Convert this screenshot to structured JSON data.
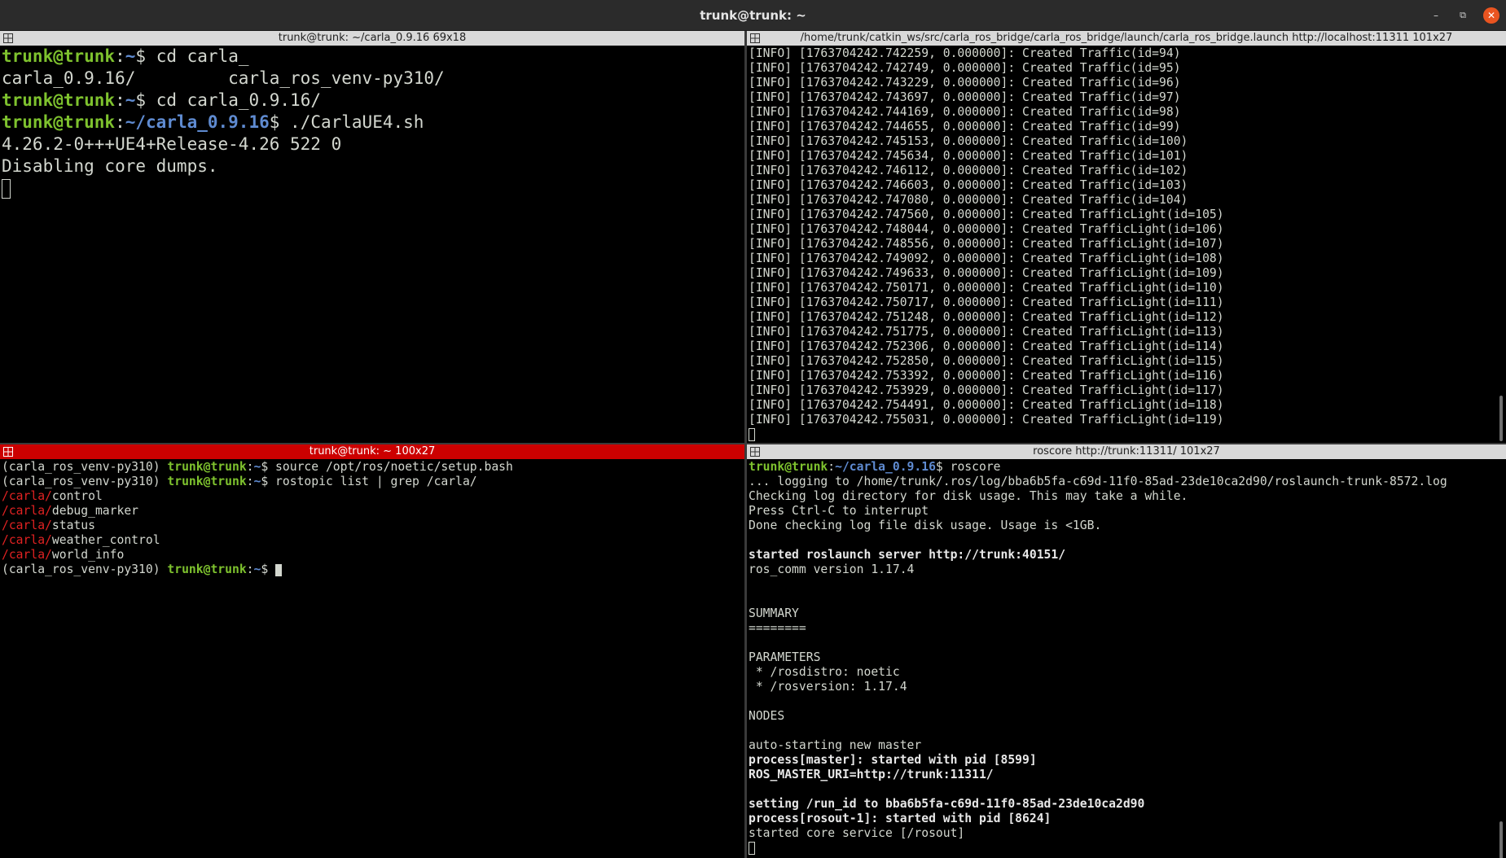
{
  "window": {
    "title": "trunk@trunk: ~",
    "controls": {
      "minimize": "–",
      "maximize": "⧉",
      "close": "✕"
    }
  },
  "colors": {
    "prompt_user": "#7ec22e",
    "prompt_path": "#5f8bd1",
    "grep_match": "#e02222",
    "active_pane_bar": "#cc0000",
    "inactive_pane_bar": "#d9d9d9"
  },
  "panes": {
    "top_left": {
      "title": "trunk@trunk: ~/carla_0.9.16 69x18",
      "lines": {
        "l1": {
          "user": "trunk@trunk",
          "sep": ":",
          "path": "~",
          "dollar": "$ ",
          "cmd": "cd carla_"
        },
        "l2": {
          "text": "carla_0.9.16/         carla_ros_venv-py310/"
        },
        "l3": {
          "user": "trunk@trunk",
          "sep": ":",
          "path": "~",
          "dollar": "$ ",
          "cmd": "cd carla_0.9.16/"
        },
        "l4": {
          "user": "trunk@trunk",
          "sep": ":",
          "path": "~/carla_0.9.16",
          "dollar": "$ ",
          "cmd": "./CarlaUE4.sh"
        },
        "l5": {
          "text": "4.26.2-0+++UE4+Release-4.26 522 0"
        },
        "l6": {
          "text": "Disabling core dumps."
        }
      }
    },
    "top_right": {
      "title": "/home/trunk/catkin_ws/src/carla_ros_bridge/carla_ros_bridge/launch/carla_ros_bridge.launch http://localhost:11311 101x27",
      "log": [
        "[INFO] [1763704242.742259, 0.000000]: Created Traffic(id=94)",
        "[INFO] [1763704242.742749, 0.000000]: Created Traffic(id=95)",
        "[INFO] [1763704242.743229, 0.000000]: Created Traffic(id=96)",
        "[INFO] [1763704242.743697, 0.000000]: Created Traffic(id=97)",
        "[INFO] [1763704242.744169, 0.000000]: Created Traffic(id=98)",
        "[INFO] [1763704242.744655, 0.000000]: Created Traffic(id=99)",
        "[INFO] [1763704242.745153, 0.000000]: Created Traffic(id=100)",
        "[INFO] [1763704242.745634, 0.000000]: Created Traffic(id=101)",
        "[INFO] [1763704242.746112, 0.000000]: Created Traffic(id=102)",
        "[INFO] [1763704242.746603, 0.000000]: Created Traffic(id=103)",
        "[INFO] [1763704242.747080, 0.000000]: Created Traffic(id=104)",
        "[INFO] [1763704242.747560, 0.000000]: Created TrafficLight(id=105)",
        "[INFO] [1763704242.748044, 0.000000]: Created TrafficLight(id=106)",
        "[INFO] [1763704242.748556, 0.000000]: Created TrafficLight(id=107)",
        "[INFO] [1763704242.749092, 0.000000]: Created TrafficLight(id=108)",
        "[INFO] [1763704242.749633, 0.000000]: Created TrafficLight(id=109)",
        "[INFO] [1763704242.750171, 0.000000]: Created TrafficLight(id=110)",
        "[INFO] [1763704242.750717, 0.000000]: Created TrafficLight(id=111)",
        "[INFO] [1763704242.751248, 0.000000]: Created TrafficLight(id=112)",
        "[INFO] [1763704242.751775, 0.000000]: Created TrafficLight(id=113)",
        "[INFO] [1763704242.752306, 0.000000]: Created TrafficLight(id=114)",
        "[INFO] [1763704242.752850, 0.000000]: Created TrafficLight(id=115)",
        "[INFO] [1763704242.753392, 0.000000]: Created TrafficLight(id=116)",
        "[INFO] [1763704242.753929, 0.000000]: Created TrafficLight(id=117)",
        "[INFO] [1763704242.754491, 0.000000]: Created TrafficLight(id=118)",
        "[INFO] [1763704242.755031, 0.000000]: Created TrafficLight(id=119)"
      ]
    },
    "bottom_left": {
      "title": "trunk@trunk: ~ 100x27",
      "venv": "(carla_ros_venv-py310) ",
      "user": "trunk@trunk",
      "sep": ":",
      "path": "~",
      "dollar": "$ ",
      "cmd1": "source /opt/ros/noetic/setup.bash",
      "cmd2": "rostopic list | grep /carla/",
      "match": "/carla/",
      "topics": [
        "control",
        "debug_marker",
        "status",
        "weather_control",
        "world_info"
      ]
    },
    "bottom_right": {
      "title": "roscore http://trunk:11311/ 101x27",
      "prompt": {
        "user": "trunk@trunk",
        "sep": ":",
        "path": "~/carla_0.9.16",
        "dollar": "$ ",
        "cmd": "roscore"
      },
      "lines": {
        "logging": "... logging to /home/trunk/.ros/log/bba6b5fa-c69d-11f0-85ad-23de10ca2d90/roslaunch-trunk-8572.log",
        "checking": "Checking log directory for disk usage. This may take a while.",
        "press": "Press Ctrl-C to interrupt",
        "done": "Done checking log file disk usage. Usage is <1GB.",
        "started_server": "started roslaunch server http://trunk:40151/",
        "ros_comm": "ros_comm version 1.17.4",
        "summary": "SUMMARY",
        "summary_rule": "========",
        "parameters": "PARAMETERS",
        "param1": " * /rosdistro: noetic",
        "param2": " * /rosversion: 1.17.4",
        "nodes": "NODES",
        "auto_start": "auto-starting new master",
        "process_master": "process[master]: started with pid [8599]",
        "master_uri": "ROS_MASTER_URI=http://trunk:11311/",
        "run_id": "setting /run_id to bba6b5fa-c69d-11f0-85ad-23de10ca2d90",
        "process_rosout": "process[rosout-1]: started with pid [8624]",
        "core_service": "started core service [/rosout]"
      }
    }
  }
}
